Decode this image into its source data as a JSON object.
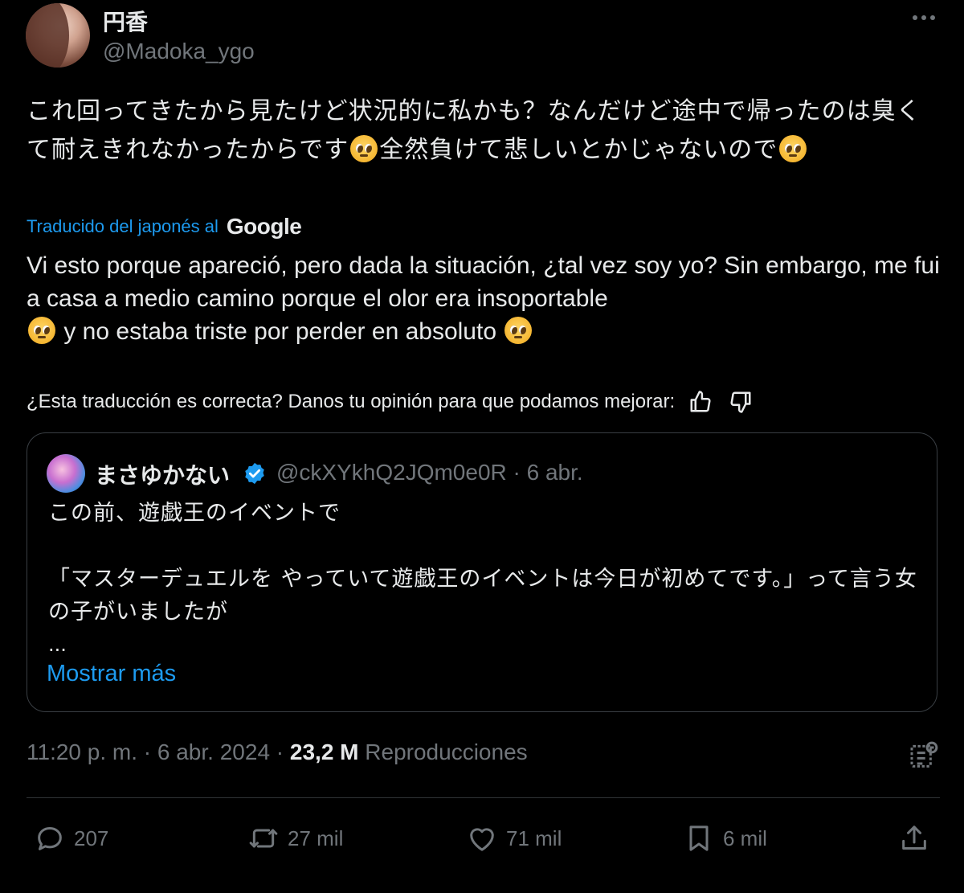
{
  "author": {
    "display_name": "円香",
    "handle": "@Madoka_ygo"
  },
  "tweet": {
    "jp_text_1": "これ回ってきたから見たけど状況的に私かも？なんだけど途中で帰ったのは臭くて耐えきれなかったからです",
    "jp_text_2": "全然負けて悲しいとかじゃないので",
    "translated_by_label": "Traducido del japonés al",
    "translator_brand": "Google",
    "es_text_1": "Vi esto porque apareció, pero dada la situación, ¿tal vez soy yo? Sin embargo, me fui a casa a medio camino porque el olor era insoportable",
    "es_text_2": "y no estaba triste por perder en absoluto",
    "emoji_name": "pleading-face-icon",
    "feedback_prompt": "¿Esta traducción es correcta? Danos tu opinión para que podamos mejorar:"
  },
  "quoted": {
    "display_name": "まさゆかない",
    "handle_and_date": "@ckXYkhQ2JQm0e0R · 6 abr.",
    "line_1": "この前、遊戯王のイベントで",
    "line_2": "「マスターデュエルを やっていて遊戯王のイベントは今日が初めてです。」って言う女の子がいましたが",
    "ellipsis": "...",
    "show_more": "Mostrar más"
  },
  "meta": {
    "timestamp": "11:20 p. m. · 6 abr. 2024 · ",
    "views_count": "23,2 M",
    "views_label": "Reproducciones"
  },
  "actions": {
    "replies": "207",
    "retweets": "27 mil",
    "likes": "71 mil",
    "bookmarks": "6 mil"
  },
  "colors": {
    "background": "#000000",
    "text": "#e7e9ea",
    "secondary": "#71767b",
    "accent": "#1d9bf0"
  }
}
